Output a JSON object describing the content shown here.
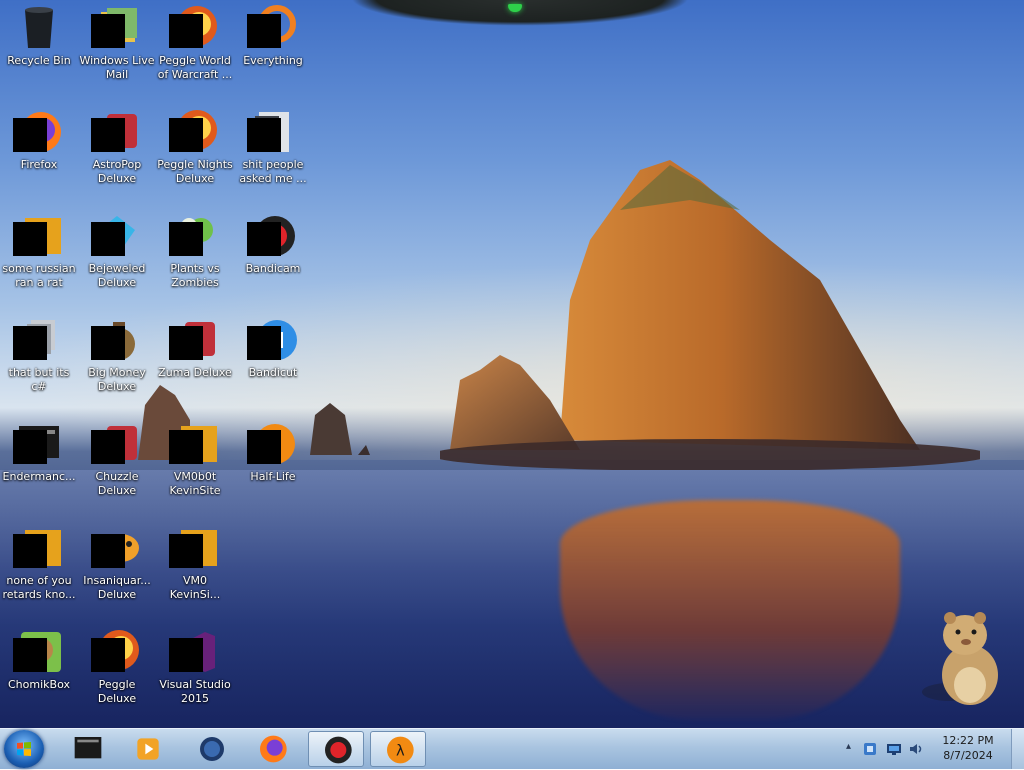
{
  "desktop": {
    "icons": [
      {
        "label": "Recycle Bin",
        "icon": "recycle-bin-icon",
        "col": 0,
        "row": 0
      },
      {
        "label": "Windows Live Mail",
        "icon": "mail-icon",
        "col": 1,
        "row": 0
      },
      {
        "label": "Peggle World of Warcraft ...",
        "icon": "peggle-icon",
        "col": 2,
        "row": 0
      },
      {
        "label": "Everything",
        "icon": "search-icon",
        "col": 3,
        "row": 0
      },
      {
        "label": "Firefox",
        "icon": "firefox-icon",
        "col": 0,
        "row": 1
      },
      {
        "label": "AstroPop Deluxe",
        "icon": "game-icon",
        "col": 1,
        "row": 1
      },
      {
        "label": "Peggle Nights Deluxe",
        "icon": "peggle-icon",
        "col": 2,
        "row": 1
      },
      {
        "label": "shit people asked me ...",
        "icon": "folder-icon",
        "col": 3,
        "row": 1
      },
      {
        "label": "some russian ran a rat",
        "icon": "app-icon",
        "col": 0,
        "row": 2
      },
      {
        "label": "Bejeweled Deluxe",
        "icon": "gem-icon",
        "col": 1,
        "row": 2
      },
      {
        "label": "Plants vs Zombies",
        "icon": "plant-icon",
        "col": 2,
        "row": 2
      },
      {
        "label": "Bandicam",
        "icon": "record-icon",
        "col": 3,
        "row": 2
      },
      {
        "label": "that but its c#",
        "icon": "file-icon",
        "col": 0,
        "row": 3
      },
      {
        "label": "Big Money Deluxe",
        "icon": "money-bag-icon",
        "col": 1,
        "row": 3
      },
      {
        "label": "Zuma Deluxe",
        "icon": "game-icon",
        "col": 2,
        "row": 3
      },
      {
        "label": "Bandicut",
        "icon": "video-icon",
        "col": 3,
        "row": 3
      },
      {
        "label": "Endermanc...",
        "icon": "terminal-icon",
        "col": 0,
        "row": 4
      },
      {
        "label": "Chuzzle Deluxe",
        "icon": "game-icon",
        "col": 1,
        "row": 4
      },
      {
        "label": "VM0b0t KevinSite",
        "icon": "app-icon",
        "col": 2,
        "row": 4
      },
      {
        "label": "Half-Life",
        "icon": "half-life-icon",
        "col": 3,
        "row": 4
      },
      {
        "label": "none of you retards kno...",
        "icon": "app-icon",
        "col": 0,
        "row": 5
      },
      {
        "label": "Insaniquar... Deluxe",
        "icon": "fish-icon",
        "col": 1,
        "row": 5
      },
      {
        "label": "VM0 KevinSi...",
        "icon": "app-icon",
        "col": 2,
        "row": 5
      },
      {
        "label": "ChomikBox",
        "icon": "hamster-icon",
        "col": 0,
        "row": 6
      },
      {
        "label": "Peggle Deluxe",
        "icon": "peggle-icon",
        "col": 1,
        "row": 6
      },
      {
        "label": "Visual Studio 2015",
        "icon": "visual-studio-icon",
        "col": 2,
        "row": 6
      }
    ]
  },
  "taskbar": {
    "pinned": [
      {
        "name": "terminal",
        "icon": "terminal-icon",
        "active": false
      },
      {
        "name": "media-player",
        "icon": "media-player-icon",
        "active": false
      },
      {
        "name": "globe",
        "icon": "globe-icon",
        "active": false
      },
      {
        "name": "firefox",
        "icon": "firefox-icon",
        "active": false
      },
      {
        "name": "bandicam",
        "icon": "record-icon",
        "active": true
      },
      {
        "name": "half-life",
        "icon": "half-life-icon",
        "active": true
      }
    ],
    "tray": {
      "time": "12:22 PM",
      "date": "8/7/2024",
      "show_hidden": "▴"
    }
  }
}
